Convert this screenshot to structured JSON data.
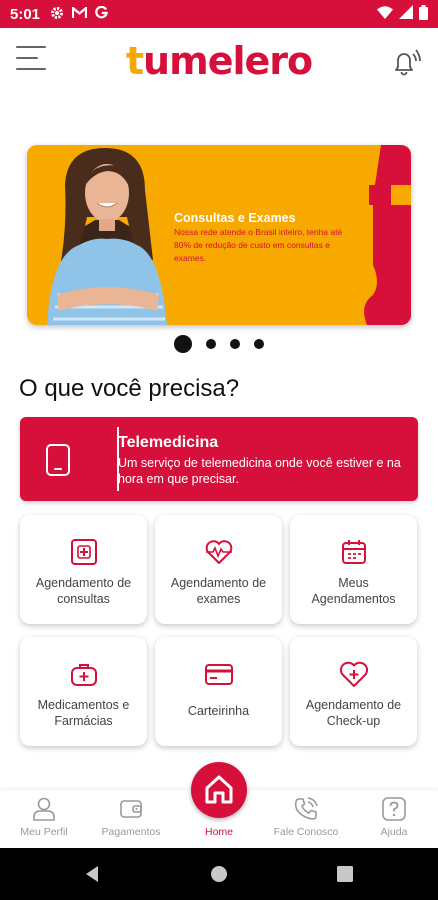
{
  "status_bar": {
    "time": "5:01",
    "icons": [
      "gear-icon",
      "gmail-icon",
      "google-icon",
      "wifi-icon",
      "signal-icon",
      "battery-icon"
    ]
  },
  "header": {
    "logo_text_accent": "t",
    "logo_text_main": "umelero",
    "menu_icon": "hamburger-menu-icon",
    "notification_icon": "bell-ringing-icon"
  },
  "banner": {
    "title": "Consultas e Exames",
    "text": "Nossa rede atende o Brasil inteiro, tenha até 80% de redução de custo em consultas e exames.",
    "slides_total": 4,
    "active_slide": 1
  },
  "section": {
    "title": "O que você precisa?"
  },
  "telemedicina": {
    "title": "Telemedicina",
    "description": "Um serviço de telemedicina onde você estiver e na hora em que precisar.",
    "icon": "smartphone-icon"
  },
  "tiles": [
    {
      "label": "Agendamento de consultas",
      "icon": "medical-cross-icon"
    },
    {
      "label": "Agendamento de exames",
      "icon": "heartbeat-icon"
    },
    {
      "label": "Meus Agendamentos",
      "icon": "calendar-icon"
    },
    {
      "label": "Medicamentos e Farmácias",
      "icon": "medkit-icon"
    },
    {
      "label": "Carteirinha",
      "icon": "card-icon"
    },
    {
      "label": "Agendamento de Check-up",
      "icon": "heart-plus-icon"
    }
  ],
  "bottom_nav": {
    "profile": "Meu Perfil",
    "payments": "Pagamentos",
    "home": "Home",
    "contact": "Fale Conosco",
    "help": "Ajuda"
  },
  "colors": {
    "brand_red": "#d6103a",
    "brand_yellow": "#f7a900"
  }
}
